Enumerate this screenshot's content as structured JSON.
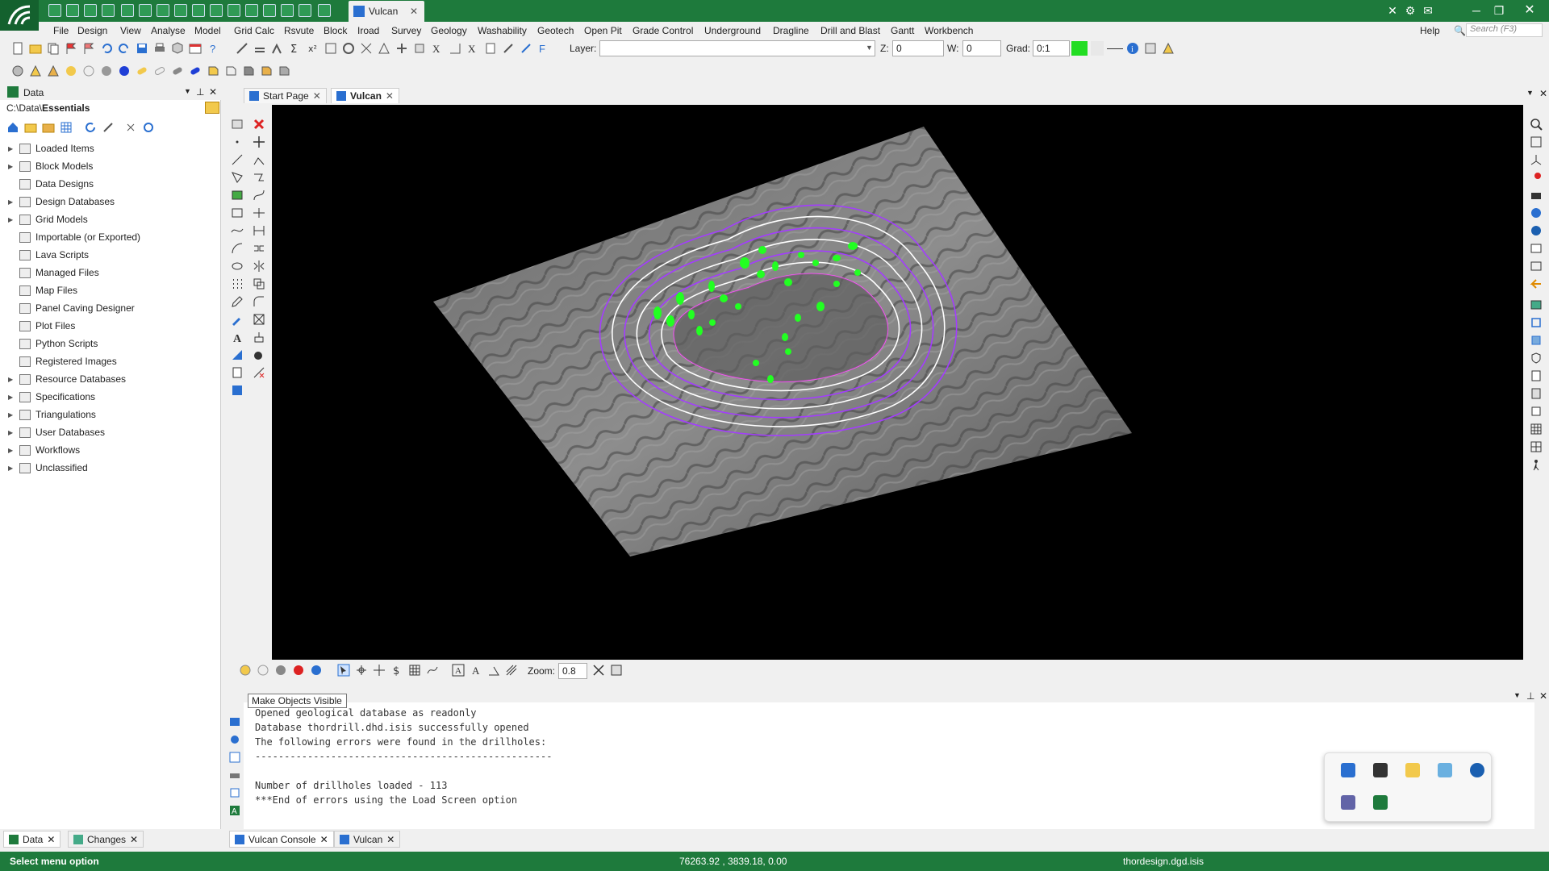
{
  "app": {
    "doc_tab": "Vulcan",
    "colors": {
      "brand_green": "#1e7a3c",
      "status_green": "#1e7a3c",
      "dip_green": "#22dd22",
      "contour_purple": "#a33cff"
    }
  },
  "menu": {
    "file": "File",
    "design": "Design",
    "view": "View",
    "analyse": "Analyse",
    "model": "Model",
    "grid_calc": "Grid Calc",
    "rsvute": "Rsvute",
    "block": "Block",
    "iroad": "Iroad",
    "survey": "Survey",
    "geology": "Geology",
    "washability": "Washability",
    "geotech": "Geotech",
    "open_pit": "Open Pit",
    "grade_control": "Grade Control",
    "underground": "Underground",
    "dragline": "Dragline",
    "drill_and_blast": "Drill and Blast",
    "gantt": "Gantt",
    "workbench": "Workbench",
    "help": "Help",
    "search_placeholder": "Search (F3)"
  },
  "toolbar": {
    "layer_label": "Layer:",
    "layer_value": "",
    "z_label": "Z:",
    "z_value": "0",
    "w_label": "W:",
    "w_value": "0",
    "grad_label": "Grad:",
    "grad_value": "0:1"
  },
  "data_panel": {
    "title": "Data",
    "path_prefix": "C:\\Data\\",
    "path_folder": "Essentials",
    "items": [
      {
        "label": "Loaded Items",
        "expandable": true
      },
      {
        "label": "Block Models",
        "expandable": true
      },
      {
        "label": "Data Designs",
        "expandable": false
      },
      {
        "label": "Design Databases",
        "expandable": true
      },
      {
        "label": "Grid Models",
        "expandable": true
      },
      {
        "label": "Importable (or Exported)",
        "expandable": false
      },
      {
        "label": "Lava Scripts",
        "expandable": false
      },
      {
        "label": "Managed Files",
        "expandable": false
      },
      {
        "label": "Map Files",
        "expandable": false
      },
      {
        "label": "Panel Caving Designer",
        "expandable": false
      },
      {
        "label": "Plot Files",
        "expandable": false
      },
      {
        "label": "Python Scripts",
        "expandable": false
      },
      {
        "label": "Registered Images",
        "expandable": false
      },
      {
        "label": "Resource Databases",
        "expandable": true
      },
      {
        "label": "Specifications",
        "expandable": true
      },
      {
        "label": "Triangulations",
        "expandable": true
      },
      {
        "label": "User Databases",
        "expandable": true
      },
      {
        "label": "Workflows",
        "expandable": true
      },
      {
        "label": "Unclassified",
        "expandable": true
      }
    ]
  },
  "doc_tabs": {
    "start_page": "Start Page",
    "vulcan": "Vulcan"
  },
  "view_toolbar": {
    "zoom_label": "Zoom:",
    "zoom_value": "0.8"
  },
  "tooltip": "Make Objects Visible",
  "console": {
    "lines": [
      "Opened geological database as readonly",
      "Database thordrill.dhd.isis successfully opened",
      "The following errors were found in the drillholes:",
      "---------------------------------------------------",
      "",
      "Number of drillholes loaded - 113",
      "***End of errors using the Load Screen option"
    ]
  },
  "bottom_tabs": {
    "data": "Data",
    "changes": "Changes",
    "vulcan_console": "Vulcan Console",
    "vulcan": "Vulcan"
  },
  "status": {
    "message": "Select menu option",
    "coordinates": "76263.92 , 3839.18, 0.00",
    "file": "thordesign.dgd.isis"
  }
}
